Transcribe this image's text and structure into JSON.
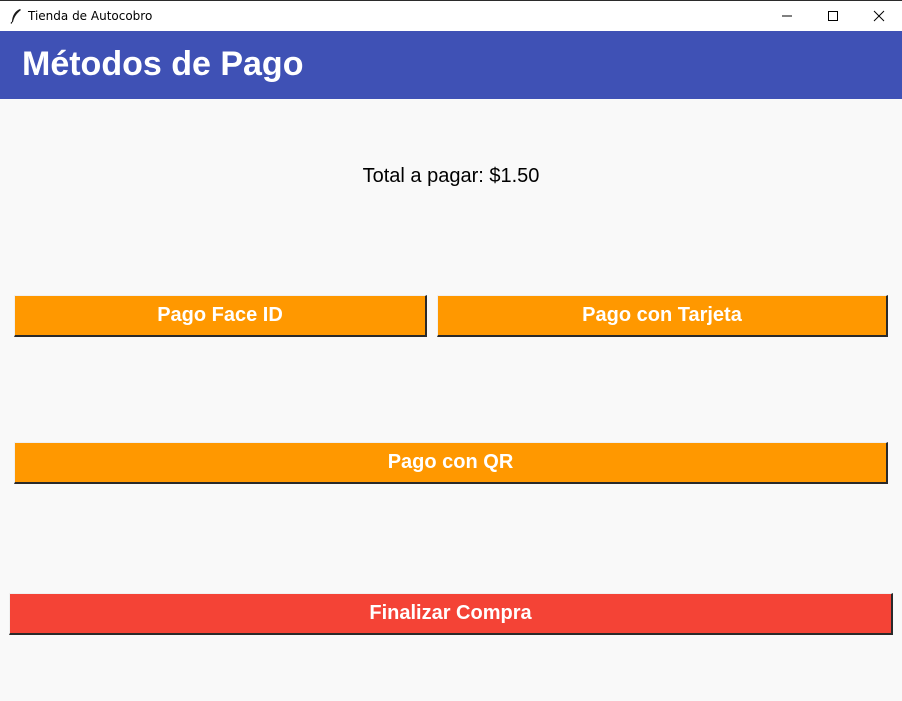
{
  "window": {
    "title": "Tienda de Autocobro",
    "controls": [
      "minimize-icon",
      "maximize-icon",
      "close-icon"
    ]
  },
  "header": {
    "title": "Métodos de Pago",
    "background": "#3f51b5"
  },
  "summary": {
    "total_text": "Total a pagar: $1.50"
  },
  "payment_methods": {
    "face_id_label": "Pago Face ID",
    "card_label": "Pago con Tarjeta",
    "qr_label": "Pago con QR",
    "button_color": "#ff9800"
  },
  "actions": {
    "finish_label": "Finalizar Compra",
    "finish_color": "#f44336"
  }
}
